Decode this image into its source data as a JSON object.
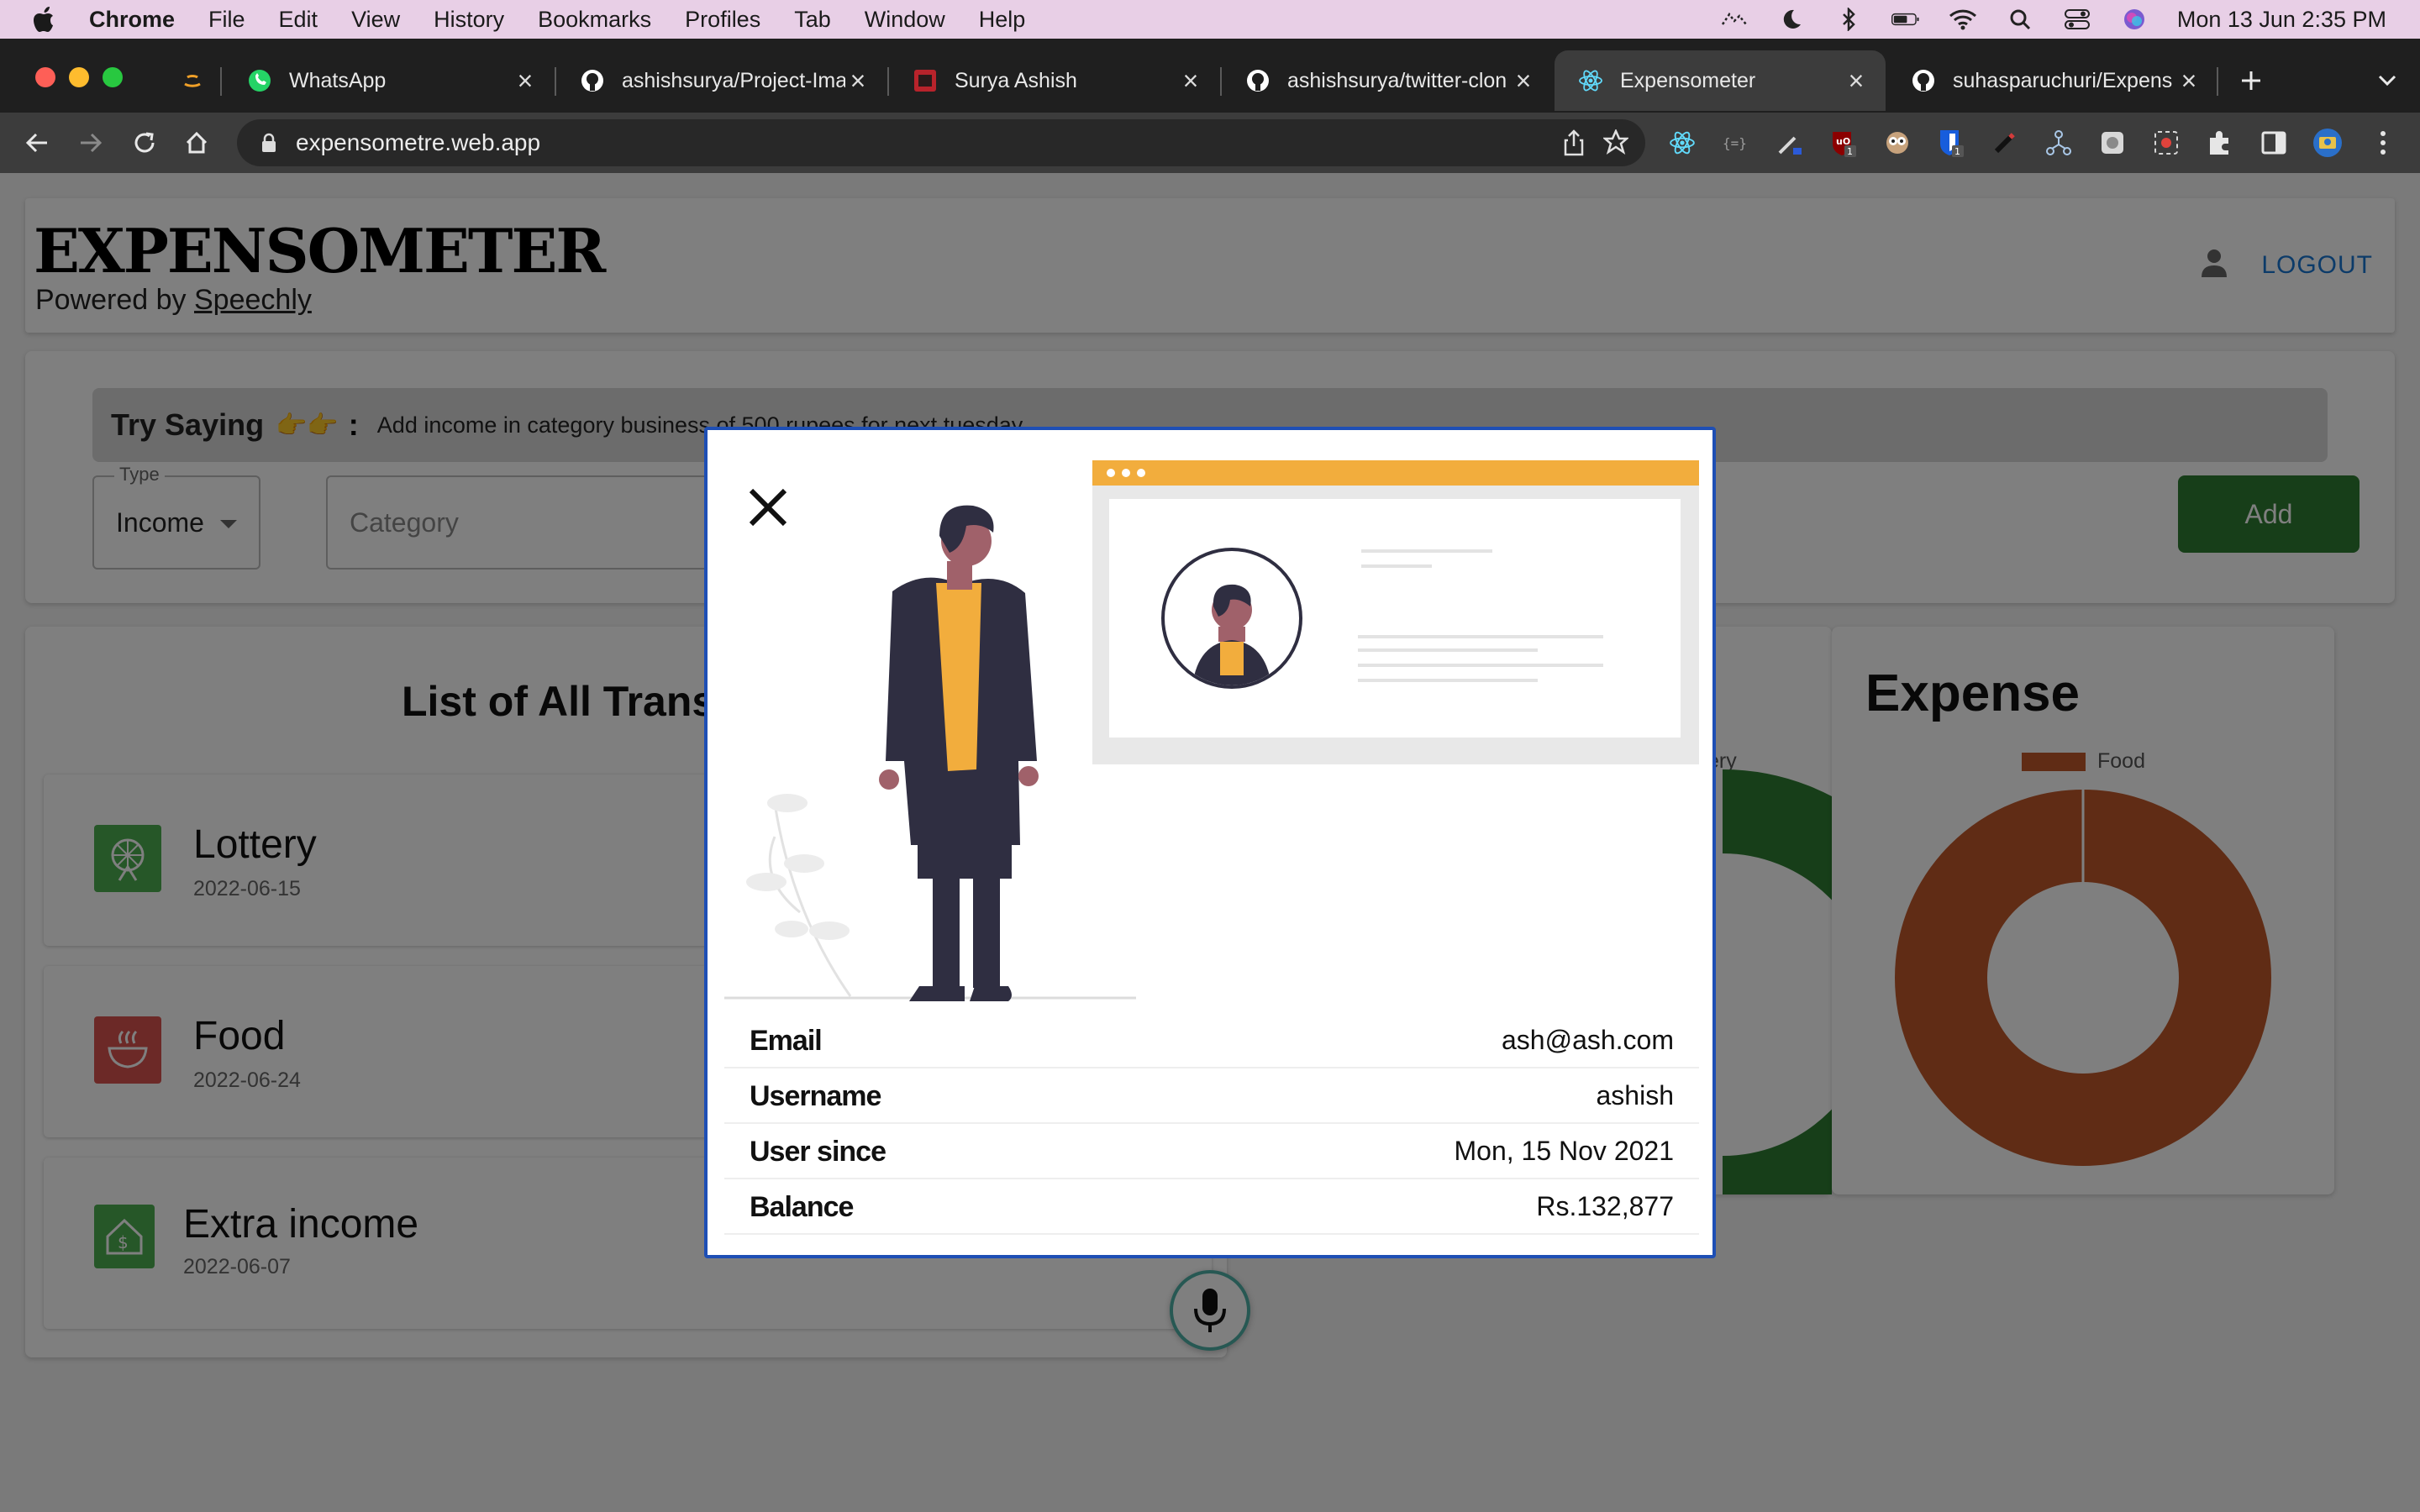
{
  "menubar": {
    "app": "Chrome",
    "items": [
      "File",
      "Edit",
      "View",
      "History",
      "Bookmarks",
      "Profiles",
      "Tab",
      "Window",
      "Help"
    ],
    "clock": "Mon 13 Jun  2:35 PM"
  },
  "tabs": [
    {
      "title": "WhatsApp"
    },
    {
      "title": "ashishsurya/Project-Ima"
    },
    {
      "title": "Surya Ashish"
    },
    {
      "title": "ashishsurya/twitter-clon"
    },
    {
      "title": "Expensometer"
    },
    {
      "title": "suhasparuchuri/Expens"
    }
  ],
  "address": {
    "url": "expensometre.web.app"
  },
  "extensions": {
    "badge_count": "1"
  },
  "header": {
    "logo": "EXPENSOMETER",
    "powered_prefix": "Powered by ",
    "powered_link": "Speechly",
    "logout": "LOGOUT"
  },
  "form": {
    "try_label": "Try Saying",
    "try_emoji": "👉👉",
    "try_colon": ":",
    "try_hint": "Add income in category business of 500 rupees for next tuesday",
    "type_label": "Type",
    "type_value": "Income",
    "category_placeholder": "Category",
    "add": "Add"
  },
  "list": {
    "title": "List of All Transactions",
    "items": [
      {
        "name": "Lottery",
        "date": "2022-06-15"
      },
      {
        "name": "Food",
        "date": "2022-06-24"
      },
      {
        "name": "Extra income",
        "date": "2022-06-07"
      }
    ]
  },
  "income_chart": {
    "legend_partial": "ery"
  },
  "expense_chart": {
    "title": "Expense",
    "legend": "Food"
  },
  "profile": {
    "rows": [
      {
        "label": "Email",
        "value": "ash@ash.com"
      },
      {
        "label": "Username",
        "value": "ashish"
      },
      {
        "label": "User since",
        "value": "Mon, 15 Nov 2021"
      },
      {
        "label": "Balance",
        "value": "Rs.132,877"
      }
    ]
  },
  "colors": {
    "income_green": "#2e7d32",
    "expense_brown": "#c0582b",
    "accent_blue": "#1976d2",
    "illustration_yellow": "#f2ad3d"
  }
}
